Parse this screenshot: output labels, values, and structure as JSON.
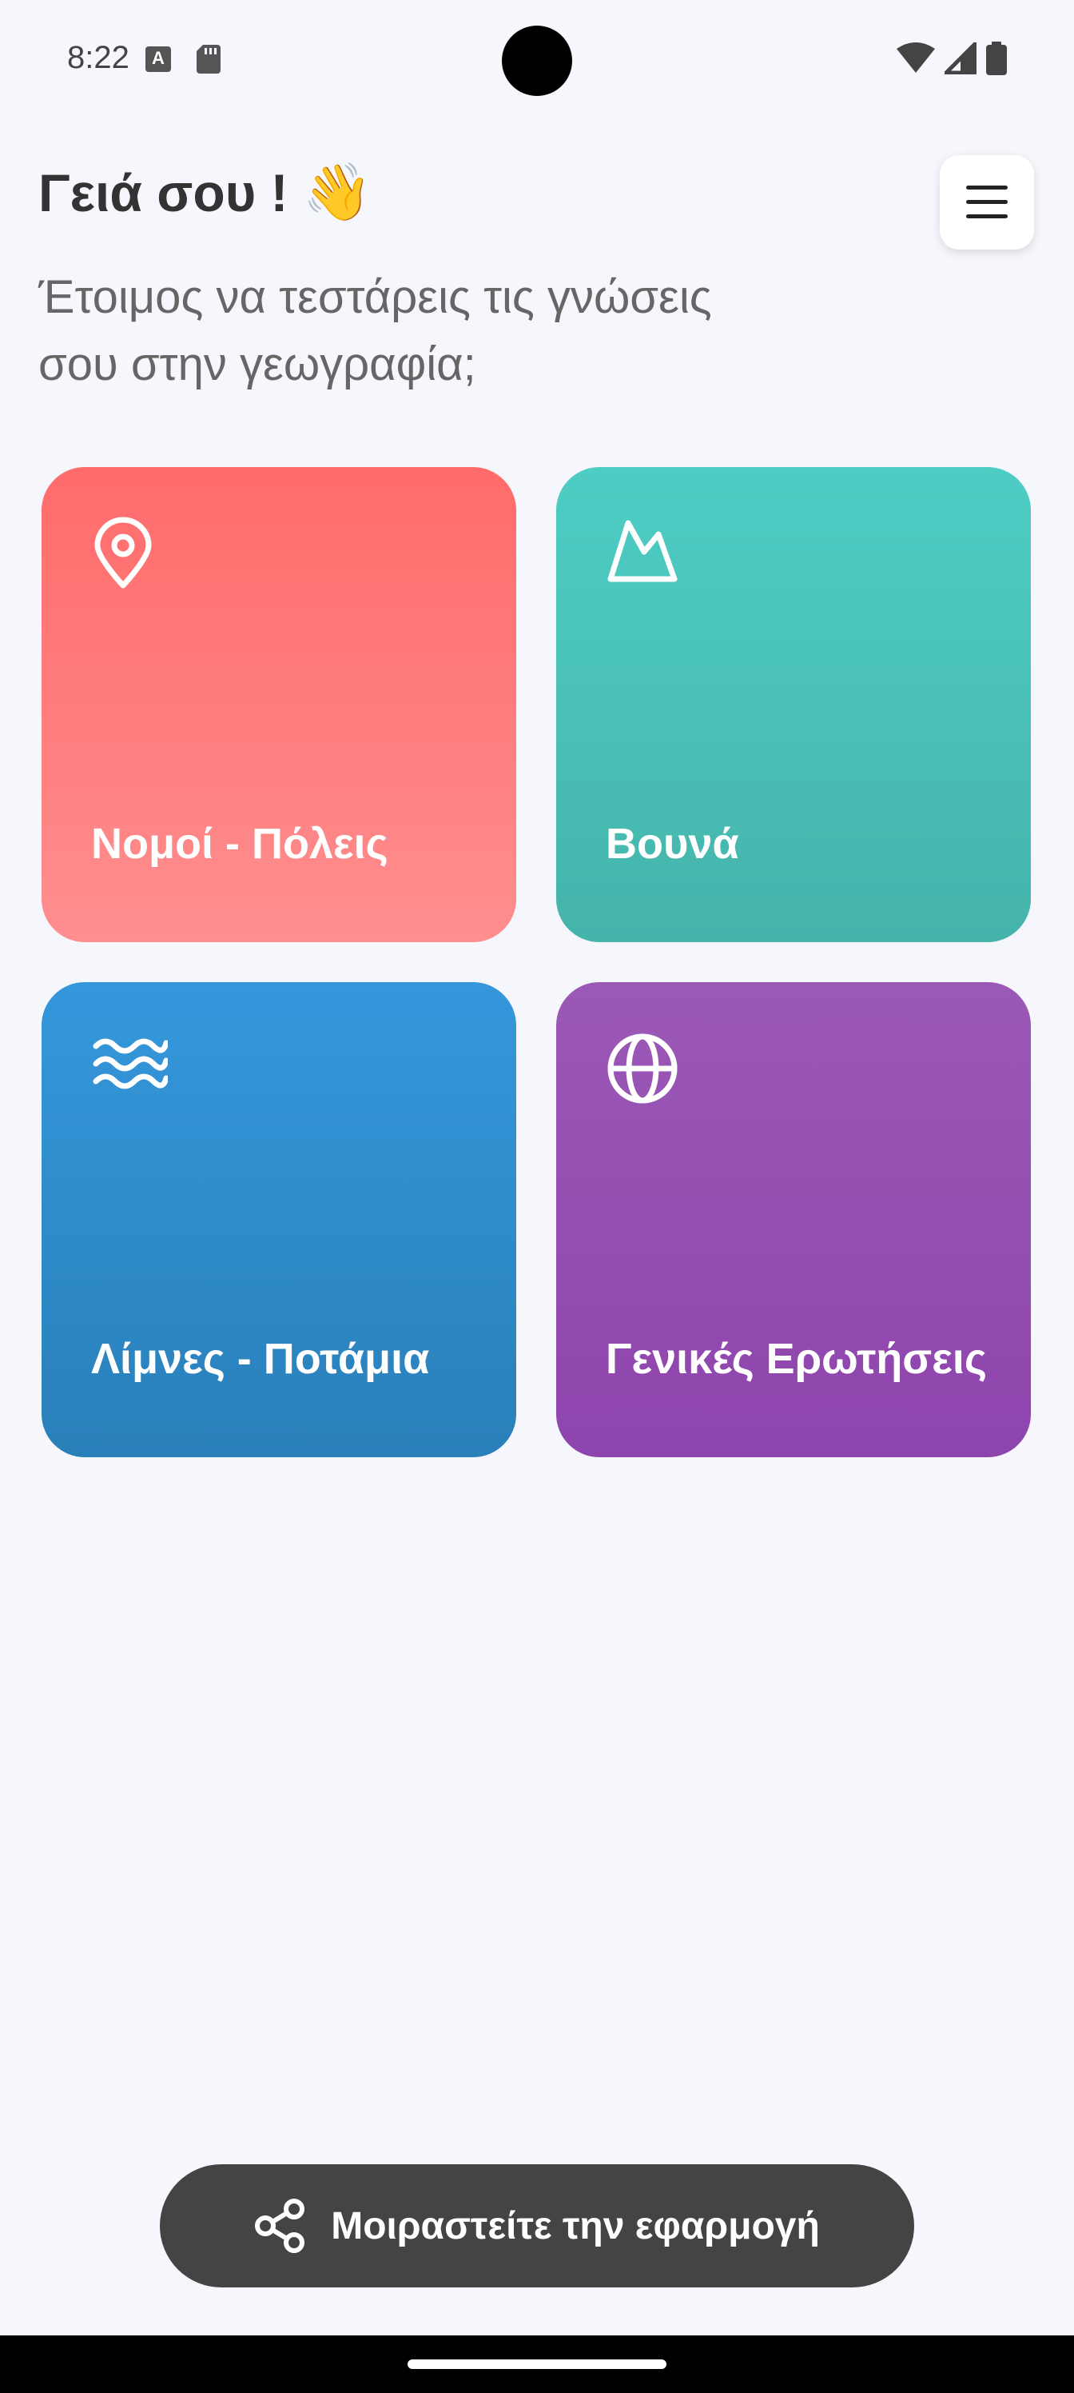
{
  "status": {
    "time": "8:22",
    "app_icon_letter": "A"
  },
  "header": {
    "greeting": "Γειά σου !",
    "wave_emoji": "👋",
    "subtitle_line1": "Έτοιμος να τεστάρεις τις γνώσεις",
    "subtitle_line2": "σου στην γεωγραφία;"
  },
  "cards": [
    {
      "label": "Νομοί - Πόλεις",
      "icon": "location-pin-icon",
      "color_top": "#ff6b6b",
      "color_bottom": "#ff8e8e"
    },
    {
      "label": "Βουνά",
      "icon": "mountain-icon",
      "color_top": "#4ecdc4",
      "color_bottom": "#45b4ab"
    },
    {
      "label": "Λίμνες - Ποτάμια",
      "icon": "water-waves-icon",
      "color_top": "#3597dc",
      "color_bottom": "#2980b9"
    },
    {
      "label": "Γενικές Ερωτήσεις",
      "icon": "globe-icon",
      "color_top": "#9b59b6",
      "color_bottom": "#8e44ad"
    }
  ],
  "share": {
    "label": "Μοιραστείτε την εφαρμογή",
    "icon": "share-icon",
    "color": "#444444"
  },
  "colors": {
    "background": "#f6f7fc"
  }
}
